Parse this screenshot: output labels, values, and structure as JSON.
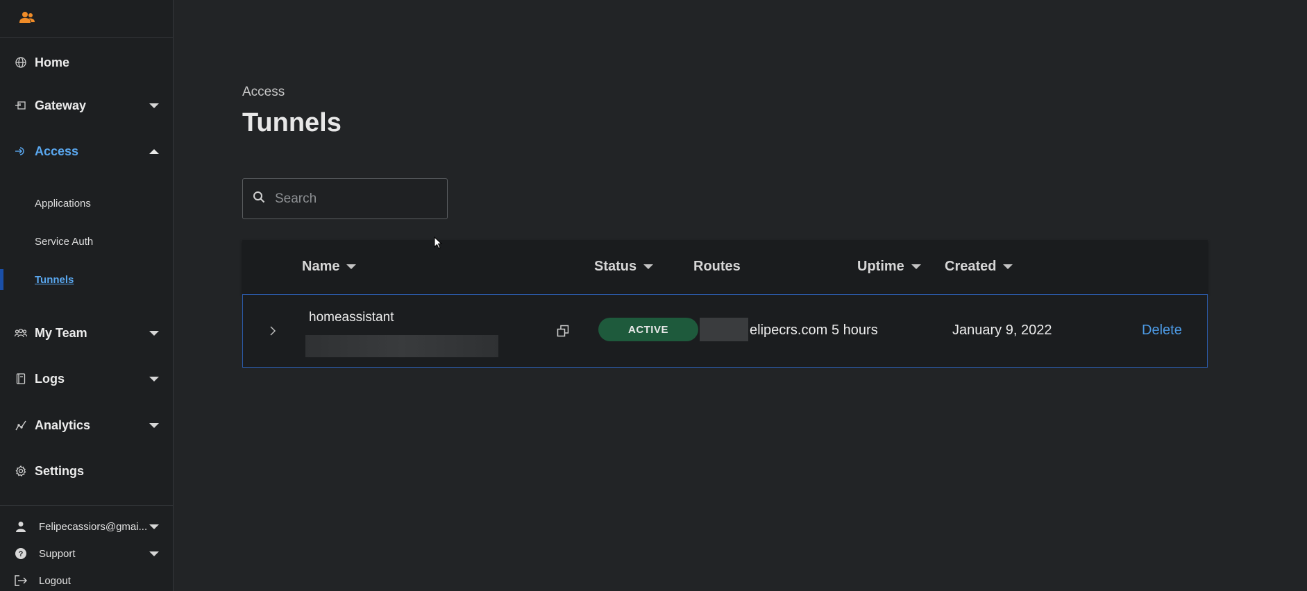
{
  "sidebar": {
    "nav": {
      "home": "Home",
      "gateway": "Gateway",
      "access": "Access",
      "my_team": "My Team",
      "logs": "Logs",
      "analytics": "Analytics",
      "settings": "Settings"
    },
    "access_sub": {
      "applications": "Applications",
      "service_auth": "Service Auth",
      "tunnels": "Tunnels"
    },
    "bottom": {
      "account": "Felipecassiors@gmai...",
      "support": "Support",
      "logout": "Logout"
    }
  },
  "main": {
    "breadcrumb": "Access",
    "title": "Tunnels",
    "search_placeholder": "Search",
    "table": {
      "headers": {
        "name": "Name",
        "status": "Status",
        "routes": "Routes",
        "uptime": "Uptime",
        "created": "Created"
      },
      "rows": [
        {
          "name": "homeassistant",
          "status": "ACTIVE",
          "route": "elipecrs.com",
          "uptime": "5 hours",
          "created": "January 9, 2022",
          "action": "Delete"
        }
      ]
    }
  },
  "colors": {
    "accent": "#5aa8f0",
    "active_badge": "#1e5a3c",
    "logo": "#f08c28",
    "row_border": "#2b5aa8"
  }
}
